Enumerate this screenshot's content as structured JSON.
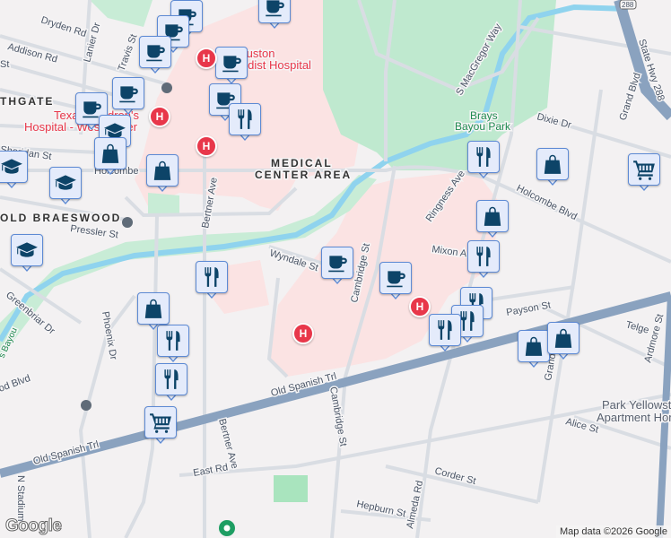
{
  "map": {
    "areas": [
      "MEDICAL",
      "CENTER AREA",
      "OLD BRAESWOOD",
      "THGATE"
    ],
    "parks": [
      "Brays",
      "Bayou Park"
    ],
    "hospitals": [
      "Texas Children's",
      "Hospital - West Tower",
      "Houston",
      "Methodist Hospital"
    ],
    "places": [
      "Park Yellowstone",
      "Apartment Homes"
    ],
    "streets": {
      "dryden": "Dryden Rd",
      "addison": "Addison Rd",
      "lanier": "Lanier Dr",
      "travis": "Travis St",
      "holcombe_w": "Holcombe",
      "holcombe_e": "Holcombe Blvd",
      "bertner_n": "Bertner Ave",
      "bertner_s": "Bertner Ave",
      "pressler": "Pressler St",
      "wyndale": "Wyndale St",
      "cambridge_n": "Cambridge St",
      "cambridge_s": "Cambridge St",
      "macgregor": "S MacGregor Way",
      "ringness": "Ringness Ave",
      "mixon": "Mixon A",
      "dixie": "Dixie Dr",
      "grand_n": "Grand Blvd",
      "grand_s": "Grand",
      "hwy288": "State Hwy 288",
      "shield288": "288",
      "payson": "Payson St",
      "telge": "Telge",
      "ardmore": "Ardmore St",
      "alice": "Alice St",
      "corder": "Corder St",
      "hepburn": "Hepburn St",
      "almeda": "Almeda Rd",
      "east": "East Rd",
      "ost_w": "Old Spanish Trl",
      "ost_e": "Old Spanish Trl",
      "greenbriar": "Greenbriar Dr",
      "phoenix": "Phoenix Dr",
      "nstadium": "N Stadium",
      "braeswood": "od Blvd",
      "bayou": "s Bayou",
      "sheridan": "Sheridan St",
      "st": "St"
    }
  },
  "markers": [
    {
      "type": "coffee-icon"
    },
    {
      "type": "coffee-icon"
    },
    {
      "type": "coffee-icon"
    },
    {
      "type": "coffee-icon"
    },
    {
      "type": "coffee-icon"
    },
    {
      "type": "coffee-icon"
    },
    {
      "type": "coffee-icon"
    },
    {
      "type": "coffee-icon"
    },
    {
      "type": "coffee-icon"
    },
    {
      "type": "coffee-icon"
    },
    {
      "type": "restaurant-icon"
    },
    {
      "type": "restaurant-icon"
    },
    {
      "type": "restaurant-icon"
    },
    {
      "type": "restaurant-icon"
    },
    {
      "type": "restaurant-icon"
    },
    {
      "type": "restaurant-icon"
    },
    {
      "type": "restaurant-icon"
    },
    {
      "type": "restaurant-icon"
    },
    {
      "type": "restaurant-icon"
    },
    {
      "type": "school-icon"
    },
    {
      "type": "school-icon"
    },
    {
      "type": "school-icon"
    },
    {
      "type": "school-icon"
    },
    {
      "type": "shopping-bag-icon"
    },
    {
      "type": "shopping-bag-icon"
    },
    {
      "type": "shopping-bag-icon"
    },
    {
      "type": "shopping-bag-icon"
    },
    {
      "type": "shopping-bag-icon"
    },
    {
      "type": "shopping-bag-icon"
    },
    {
      "type": "shopping-bag-icon"
    },
    {
      "type": "shopping-cart-icon"
    },
    {
      "type": "shopping-cart-icon"
    }
  ],
  "hospital_marker_letter": "H",
  "footer": {
    "logo": "Google",
    "attribution": "Map data ©2026 Google"
  },
  "colors": {
    "marker_fill": "#e4ebfb",
    "marker_border": "#5d8ad4",
    "icon": "#0d4468",
    "hospital": "#e8374a",
    "park": "#bfe9cf",
    "medical": "#fbe3e3",
    "highway": "#8aa2bf",
    "water": "#8fd3ee"
  }
}
